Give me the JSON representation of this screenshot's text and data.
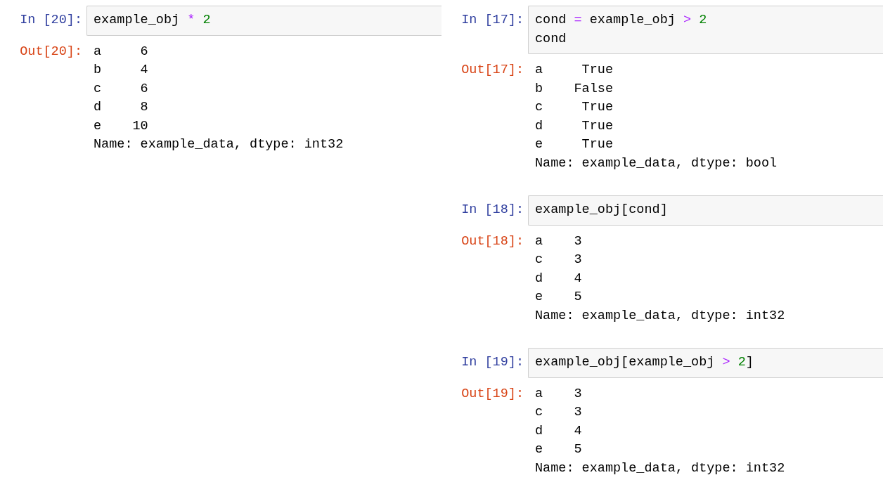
{
  "panels": [
    {
      "cells": [
        {
          "in_prompt": "In [20]:",
          "code_lines": [
            [
              {
                "kind": "name",
                "text": "example_obj "
              },
              {
                "kind": "op",
                "text": "* "
              },
              {
                "kind": "num",
                "text": "2"
              }
            ]
          ],
          "out_prompt": "Out[20]:",
          "output": [
            "a     6",
            "b     4",
            "c     6",
            "d     8",
            "e    10",
            "Name: example_data, dtype: int32"
          ]
        }
      ]
    },
    {
      "cells": [
        {
          "in_prompt": "In [17]:",
          "code_lines": [
            [
              {
                "kind": "name",
                "text": "cond "
              },
              {
                "kind": "op",
                "text": "= "
              },
              {
                "kind": "name",
                "text": "example_obj "
              },
              {
                "kind": "op",
                "text": "> "
              },
              {
                "kind": "num",
                "text": "2"
              }
            ],
            [
              {
                "kind": "name",
                "text": "cond"
              }
            ]
          ],
          "out_prompt": "Out[17]:",
          "output": [
            "a     True",
            "b    False",
            "c     True",
            "d     True",
            "e     True",
            "Name: example_data, dtype: bool"
          ]
        },
        {
          "in_prompt": "In [18]:",
          "code_lines": [
            [
              {
                "kind": "name",
                "text": "example_obj[cond]"
              }
            ]
          ],
          "out_prompt": "Out[18]:",
          "output": [
            "a    3",
            "c    3",
            "d    4",
            "e    5",
            "Name: example_data, dtype: int32"
          ]
        },
        {
          "in_prompt": "In [19]:",
          "code_lines": [
            [
              {
                "kind": "name",
                "text": "example_obj[example_obj "
              },
              {
                "kind": "op",
                "text": "> "
              },
              {
                "kind": "num",
                "text": "2"
              },
              {
                "kind": "name",
                "text": "]"
              }
            ]
          ],
          "out_prompt": "Out[19]:",
          "output": [
            "a    3",
            "c    3",
            "d    4",
            "e    5",
            "Name: example_data, dtype: int32"
          ]
        }
      ]
    }
  ]
}
